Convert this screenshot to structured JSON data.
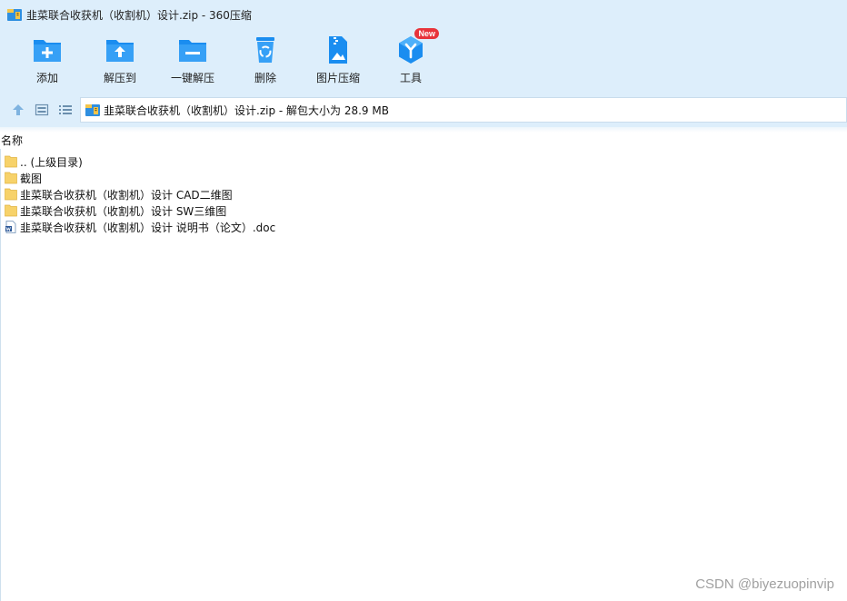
{
  "window": {
    "title": "韭菜联合收获机（收割机）设计.zip - 360压缩"
  },
  "toolbar": {
    "items": [
      {
        "label": "添加",
        "icon": "add-folder-icon"
      },
      {
        "label": "解压到",
        "icon": "extract-to-icon"
      },
      {
        "label": "一键解压",
        "icon": "one-click-extract-icon"
      },
      {
        "label": "删除",
        "icon": "trash-icon"
      },
      {
        "label": "图片压缩",
        "icon": "image-compress-icon"
      },
      {
        "label": "工具",
        "icon": "tools-cube-icon",
        "badge": "New"
      }
    ]
  },
  "navbar": {
    "address": "韭菜联合收获机（收割机）设计.zip - 解包大小为 28.9 MB"
  },
  "filelist": {
    "column_header": "名称",
    "items": [
      {
        "name": ".. (上级目录)",
        "type": "folder"
      },
      {
        "name": "截图",
        "type": "folder"
      },
      {
        "name": "韭菜联合收获机（收割机）设计 CAD二维图",
        "type": "folder"
      },
      {
        "name": "韭菜联合收获机（收割机）设计 SW三维图",
        "type": "folder"
      },
      {
        "name": "韭菜联合收获机（收割机）设计 说明书（论文）.doc",
        "type": "word-doc"
      }
    ]
  },
  "watermark": "CSDN @biyezuopinvip",
  "colors": {
    "chrome": "#ddeefb",
    "icon_blue": "#1a8df0",
    "folder_yellow": "#f7d26a",
    "badge_red": "#e8333a"
  }
}
